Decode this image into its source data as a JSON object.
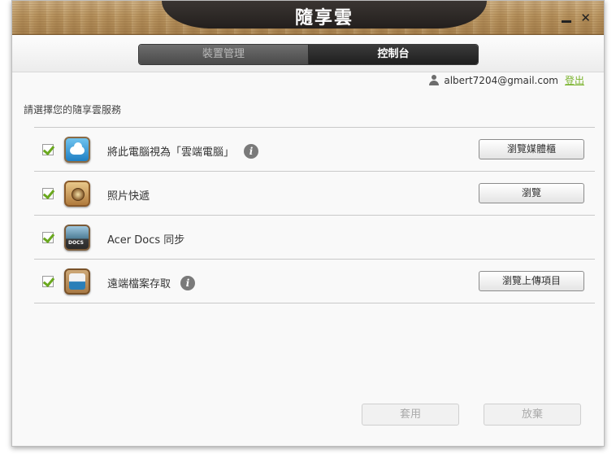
{
  "window": {
    "title": "隨享雲",
    "minimize_label": "–",
    "close_label": "✕"
  },
  "tabs": [
    {
      "label": "裝置管理",
      "active": false
    },
    {
      "label": "控制台",
      "active": true
    }
  ],
  "account": {
    "email": "albert7204@gmail.com",
    "logout_label": "登出"
  },
  "section_title": "請選擇您的隨享雲服務",
  "services": [
    {
      "label": "將此電腦視為「雲端電腦」",
      "checked": true,
      "icon": "cloud-pc-icon",
      "info": true,
      "button": "瀏覽媒體櫃"
    },
    {
      "label": "照片快遞",
      "checked": true,
      "icon": "photo-express-icon",
      "info": false,
      "button": "瀏覽"
    },
    {
      "label": "Acer Docs 同步",
      "checked": true,
      "icon": "acer-docs-icon",
      "info": false,
      "button": ""
    },
    {
      "label": "遠端檔案存取",
      "checked": true,
      "icon": "remote-files-icon",
      "info": true,
      "button": "瀏覽上傳項目"
    }
  ],
  "footer": {
    "apply_label": "套用",
    "discard_label": "放棄"
  },
  "colors": {
    "accent_green": "#6aa81e",
    "link_green": "#7bb32e",
    "title_bar": "#231f1d"
  }
}
